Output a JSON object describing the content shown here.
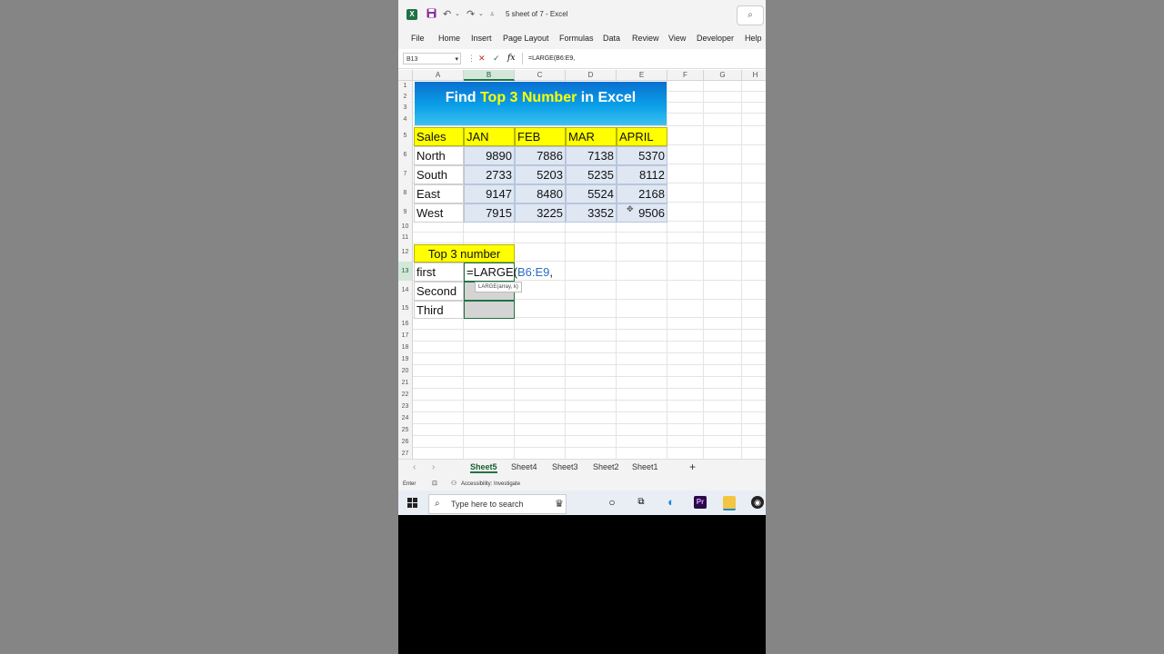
{
  "window": {
    "title": "5 sheet of 7  -  Excel",
    "app_icon": "X",
    "search_icon": "⌕"
  },
  "menu": {
    "items": [
      "File",
      "Home",
      "Insert",
      "Page Layout",
      "Formulas",
      "Data",
      "Review",
      "View",
      "Developer",
      "Help"
    ]
  },
  "formula_bar": {
    "name_box": "B13",
    "formula": "=LARGE(B6:E9,"
  },
  "grid": {
    "columns": [
      "A",
      "B",
      "C",
      "D",
      "E",
      "F",
      "G",
      "H"
    ],
    "rows": [
      "1",
      "2",
      "3",
      "4",
      "5",
      "6",
      "7",
      "8",
      "9",
      "10",
      "11",
      "12",
      "13",
      "14",
      "15",
      "16",
      "17",
      "18",
      "19",
      "20",
      "21",
      "22",
      "23",
      "24",
      "25",
      "26",
      "27"
    ]
  },
  "banner": {
    "part1": "Find ",
    "highlight": "Top 3 Number",
    "part2": " in Excel"
  },
  "table": {
    "headers": [
      "Sales",
      "JAN",
      "FEB",
      "MAR",
      "APRIL"
    ],
    "rows": [
      {
        "region": "North",
        "values": [
          "9890",
          "7886",
          "7138",
          "5370"
        ]
      },
      {
        "region": "South",
        "values": [
          "2733",
          "5203",
          "5235",
          "8112"
        ]
      },
      {
        "region": "East",
        "values": [
          "9147",
          "8480",
          "5524",
          "2168"
        ]
      },
      {
        "region": "West",
        "values": [
          "7915",
          "3225",
          "3352",
          "9506"
        ]
      }
    ]
  },
  "top3": {
    "header": "Top 3 number",
    "labels": [
      "first",
      "Second",
      "Third"
    ],
    "edit_prefix": "=LARGE(",
    "edit_ref": "B6:E9",
    "edit_suffix": ",",
    "tooltip": "LARGE(array, k)"
  },
  "sheets": {
    "tabs": [
      "Sheet5",
      "Sheet4",
      "Sheet3",
      "Sheet2",
      "Sheet1"
    ],
    "active": "Sheet5",
    "add": "+"
  },
  "status": {
    "mode": "Enter",
    "accessibility": "Accessibility: Investigate"
  },
  "taskbar": {
    "search_placeholder": "Type here to search"
  },
  "colors": {
    "excel_green": "#217346",
    "header_yellow": "#ffff00",
    "banner_blue": "#0a8fe0",
    "selection_fill": "#dfe7f3"
  }
}
